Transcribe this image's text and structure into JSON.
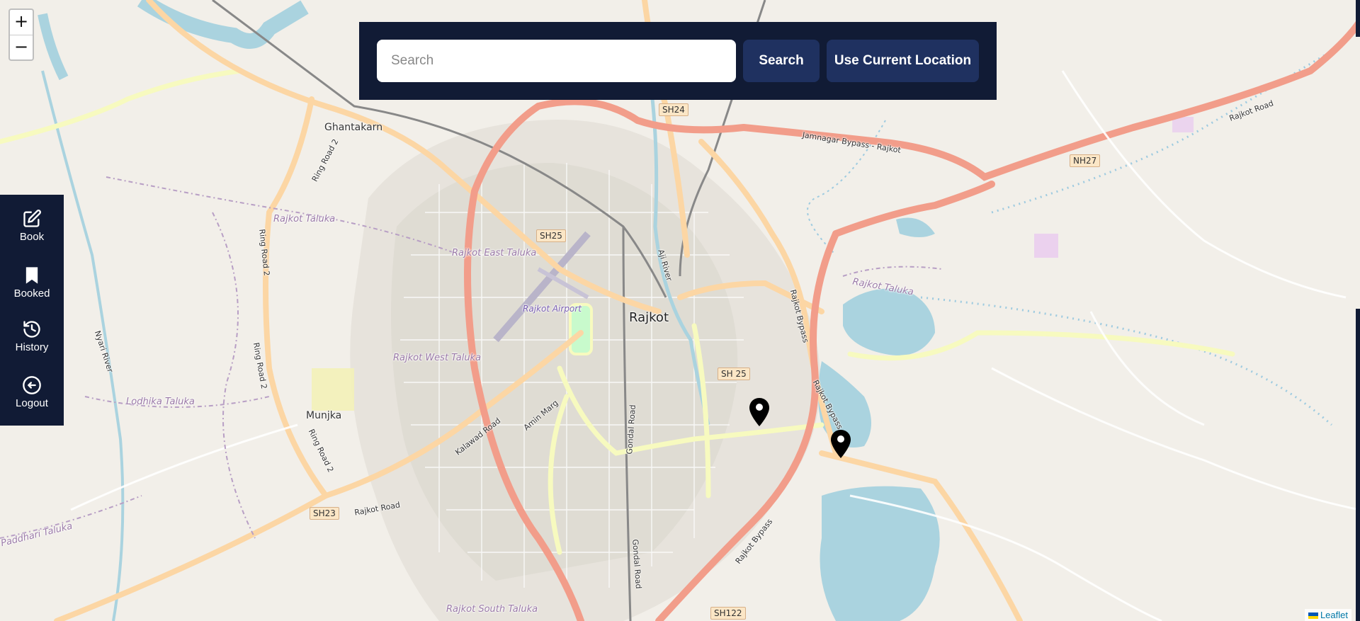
{
  "map": {
    "zoom_in_label": "+",
    "zoom_out_label": "−",
    "attribution": "Leaflet",
    "city": "Rajkot",
    "places": [
      "Ghantakarn",
      "Munjka"
    ],
    "talukas": [
      "Rajkot Taluka",
      "Rajkot East Taluka",
      "Rajkot West Taluka",
      "Lodhika Taluka",
      "Paddhari Taluka",
      "Rajkot South Taluka",
      "Rajkot Taluka"
    ],
    "airport": "Rajkot Airport",
    "river": "Aji River",
    "river2": "Nyari River",
    "road_shields": [
      "SH24",
      "NH27",
      "SH25",
      "SH 25",
      "SH23",
      "SH122"
    ],
    "road_labels": [
      "Jamnagar Bypass - Rajkot",
      "Rajkot Road",
      "Ring Road 2",
      "Kalawad Road",
      "Amin Marg",
      "Gondal Road",
      "Rajkot Bypass",
      "Rajkot Road",
      "Ring Road 2",
      "Ring Road 2",
      "Ring Road 2",
      "Rajkot Bypass",
      "Gondal Road",
      "Rajkot Bypass"
    ],
    "colors": {
      "background": "#f2efe9",
      "major_road": "#f29d8a",
      "secondary_road": "#fcd6a4",
      "tertiary_road": "#f7fabf",
      "water": "#aad3df",
      "rail": "#888888",
      "marker": "#000000"
    },
    "markers": [
      {
        "name": "location-pin-1",
        "icon": "map-pin-icon"
      },
      {
        "name": "location-pin-2",
        "icon": "map-pin-icon"
      }
    ]
  },
  "search": {
    "placeholder": "Search",
    "search_button": "Search",
    "location_button": "Use Current Location"
  },
  "sidebar": {
    "items": [
      {
        "label": "Book",
        "icon": "edit-icon"
      },
      {
        "label": "Booked",
        "icon": "bookmark-icon"
      },
      {
        "label": "History",
        "icon": "history-icon"
      },
      {
        "label": "Logout",
        "icon": "logout-icon"
      }
    ]
  },
  "theme": {
    "panel_color": "#111b35",
    "button_color": "#1f3160"
  }
}
